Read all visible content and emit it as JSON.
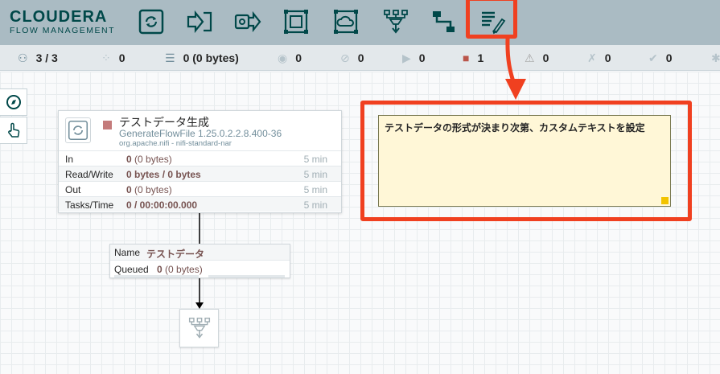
{
  "brand": {
    "name": "CLOUDERA",
    "subtitle": "FLOW MANAGEMENT"
  },
  "toolbar": {
    "buttons": [
      {
        "icon": "processor-icon"
      },
      {
        "icon": "input-port-icon"
      },
      {
        "icon": "output-port-icon"
      },
      {
        "icon": "process-group-icon"
      },
      {
        "icon": "remote-process-group-icon"
      },
      {
        "icon": "funnel-icon"
      },
      {
        "icon": "template-icon"
      },
      {
        "icon": "label-icon"
      }
    ]
  },
  "status_bar": {
    "cluster": "3 / 3",
    "threads": "0",
    "queued": "0 (0 bytes)",
    "transmitting": "0",
    "not_transmitting": "0",
    "running": "0",
    "stopped": "1",
    "invalid": "0",
    "disabled": "0",
    "up_to_date": "0"
  },
  "processor": {
    "name": "テストデータ生成",
    "type": "GenerateFlowFile 1.25.0.2.2.8.400-36",
    "bundle": "org.apache.nifi - nifi-standard-nar",
    "rows": [
      {
        "label": "In",
        "value_bold": "0",
        "value_normal": " (0 bytes)",
        "time": "5 min"
      },
      {
        "label": "Read/Write",
        "value_bold": "0 bytes / 0 bytes",
        "value_normal": "",
        "time": "5 min"
      },
      {
        "label": "Out",
        "value_bold": "0",
        "value_normal": " (0 bytes)",
        "time": "5 min"
      },
      {
        "label": "Tasks/Time",
        "value_bold": "0 / 00:00:00.000",
        "value_normal": "",
        "time": "5 min"
      }
    ]
  },
  "connection": {
    "name_label": "Name",
    "name": "テストデータ",
    "queued_label": "Queued",
    "queued_count": "0",
    "queued_size": " (0 bytes)"
  },
  "label": {
    "text": "テストデータの形式が決まり次第、カスタムテキストを設定"
  },
  "colors": {
    "header": "#aabbc3",
    "brand": "#004849",
    "stopped": "#c47b7b",
    "label_bg": "#fff7d7",
    "annotation": "#f04020"
  }
}
